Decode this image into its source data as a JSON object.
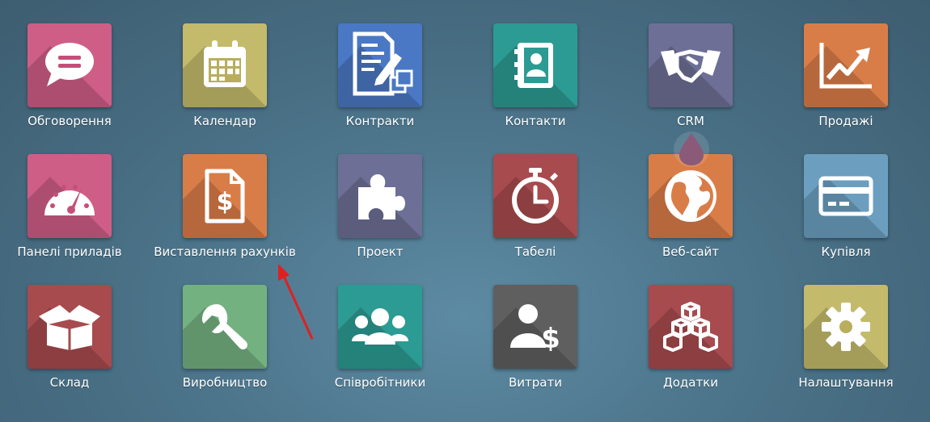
{
  "apps": [
    {
      "label": "Обговорення",
      "color": "#cf5e86",
      "icon": "chat-bubble-icon"
    },
    {
      "label": "Календар",
      "color": "#c4ba6b",
      "icon": "calendar-icon"
    },
    {
      "label": "Контракти",
      "color": "#4a78c4",
      "icon": "document-edit-icon"
    },
    {
      "label": "Контакти",
      "color": "#2b9b93",
      "icon": "address-book-icon"
    },
    {
      "label": "CRM",
      "color": "#6e6f96",
      "icon": "handshake-icon"
    },
    {
      "label": "Продажі",
      "color": "#d97d48",
      "icon": "chart-trend-icon"
    },
    {
      "label": "Панелі приладів",
      "color": "#cf5e86",
      "icon": "gauge-icon"
    },
    {
      "label": "Виставлення рахунків",
      "color": "#d97d48",
      "icon": "invoice-dollar-icon"
    },
    {
      "label": "Проект",
      "color": "#6e6f96",
      "icon": "puzzle-icon"
    },
    {
      "label": "Табелі",
      "color": "#a74b4e",
      "icon": "stopwatch-icon"
    },
    {
      "label": "Веб-сайт",
      "color": "#d97d48",
      "icon": "globe-icon"
    },
    {
      "label": "Купівля",
      "color": "#6c9fbf",
      "icon": "credit-card-icon"
    },
    {
      "label": "Склад",
      "color": "#a74b4e",
      "icon": "box-icon"
    },
    {
      "label": "Виробництво",
      "color": "#74b180",
      "icon": "wrench-icon"
    },
    {
      "label": "Співробітники",
      "color": "#2b9b93",
      "icon": "people-icon"
    },
    {
      "label": "Витрати",
      "color": "#5f5f5f",
      "icon": "person-dollar-icon"
    },
    {
      "label": "Додатки",
      "color": "#a74b4e",
      "icon": "cubes-icon"
    },
    {
      "label": "Налаштування",
      "color": "#c4ba6b",
      "icon": "gear-icon"
    }
  ]
}
